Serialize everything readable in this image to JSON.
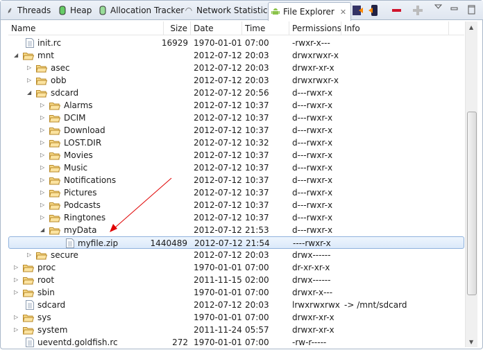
{
  "tabs": [
    {
      "label": "Threads",
      "icon": "threads-icon"
    },
    {
      "label": "Heap",
      "icon": "heap-icon"
    },
    {
      "label": "Allocation Tracker",
      "icon": "allocation-icon"
    },
    {
      "label": "Network Statistics",
      "icon": "wifi-icon"
    },
    {
      "label": "File Explorer",
      "icon": "android-icon",
      "active": true
    }
  ],
  "toolbar": [
    "pull-file-icon",
    "push-file-icon",
    "delete-icon",
    "new-folder-icon",
    "view-menu-icon",
    "minimize-icon",
    "maximize-icon"
  ],
  "columns": [
    "Name",
    "Size",
    "Date",
    "Time",
    "Permissions",
    "Info"
  ],
  "rows": [
    {
      "name": "init.rc",
      "type": "file",
      "depth": 0,
      "size": "16929",
      "date": "1970-01-01",
      "time": "07:00",
      "perm": "-rwxr-x---",
      "info": ""
    },
    {
      "name": "mnt",
      "type": "folder",
      "depth": 0,
      "expanded": true,
      "size": "",
      "date": "2012-07-12",
      "time": "20:03",
      "perm": "drwxrwxr-x",
      "info": ""
    },
    {
      "name": "asec",
      "type": "folder",
      "depth": 1,
      "size": "",
      "date": "2012-07-12",
      "time": "20:03",
      "perm": "drwxr-xr-x",
      "info": ""
    },
    {
      "name": "obb",
      "type": "folder",
      "depth": 1,
      "size": "",
      "date": "2012-07-12",
      "time": "20:03",
      "perm": "drwxrwxr-x",
      "info": ""
    },
    {
      "name": "sdcard",
      "type": "folder",
      "depth": 1,
      "expanded": true,
      "size": "",
      "date": "2012-07-12",
      "time": "20:56",
      "perm": "d---rwxr-x",
      "info": ""
    },
    {
      "name": "Alarms",
      "type": "folder",
      "depth": 2,
      "size": "",
      "date": "2012-07-12",
      "time": "10:37",
      "perm": "d---rwxr-x",
      "info": ""
    },
    {
      "name": "DCIM",
      "type": "folder",
      "depth": 2,
      "size": "",
      "date": "2012-07-12",
      "time": "10:37",
      "perm": "d---rwxr-x",
      "info": ""
    },
    {
      "name": "Download",
      "type": "folder",
      "depth": 2,
      "size": "",
      "date": "2012-07-12",
      "time": "10:37",
      "perm": "d---rwxr-x",
      "info": ""
    },
    {
      "name": "LOST.DIR",
      "type": "folder",
      "depth": 2,
      "size": "",
      "date": "2012-07-12",
      "time": "10:32",
      "perm": "d---rwxr-x",
      "info": ""
    },
    {
      "name": "Movies",
      "type": "folder",
      "depth": 2,
      "size": "",
      "date": "2012-07-12",
      "time": "10:37",
      "perm": "d---rwxr-x",
      "info": ""
    },
    {
      "name": "Music",
      "type": "folder",
      "depth": 2,
      "size": "",
      "date": "2012-07-12",
      "time": "10:37",
      "perm": "d---rwxr-x",
      "info": ""
    },
    {
      "name": "Notifications",
      "type": "folder",
      "depth": 2,
      "size": "",
      "date": "2012-07-12",
      "time": "10:37",
      "perm": "d---rwxr-x",
      "info": ""
    },
    {
      "name": "Pictures",
      "type": "folder",
      "depth": 2,
      "size": "",
      "date": "2012-07-12",
      "time": "10:37",
      "perm": "d---rwxr-x",
      "info": ""
    },
    {
      "name": "Podcasts",
      "type": "folder",
      "depth": 2,
      "size": "",
      "date": "2012-07-12",
      "time": "10:37",
      "perm": "d---rwxr-x",
      "info": ""
    },
    {
      "name": "Ringtones",
      "type": "folder",
      "depth": 2,
      "size": "",
      "date": "2012-07-12",
      "time": "10:37",
      "perm": "d---rwxr-x",
      "info": ""
    },
    {
      "name": "myData",
      "type": "folder",
      "depth": 2,
      "expanded": true,
      "size": "",
      "date": "2012-07-12",
      "time": "21:53",
      "perm": "d---rwxr-x",
      "info": ""
    },
    {
      "name": "myfile.zip",
      "type": "file",
      "depth": 3,
      "selected": true,
      "size": "1440489",
      "date": "2012-07-12",
      "time": "21:54",
      "perm": "----rwxr-x",
      "info": ""
    },
    {
      "name": "secure",
      "type": "folder",
      "depth": 1,
      "size": "",
      "date": "2012-07-12",
      "time": "20:03",
      "perm": "drwx------",
      "info": ""
    },
    {
      "name": "proc",
      "type": "folder",
      "depth": 0,
      "size": "",
      "date": "1970-01-01",
      "time": "07:00",
      "perm": "dr-xr-xr-x",
      "info": ""
    },
    {
      "name": "root",
      "type": "folder",
      "depth": 0,
      "size": "",
      "date": "2011-11-15",
      "time": "02:00",
      "perm": "drwx------",
      "info": ""
    },
    {
      "name": "sbin",
      "type": "folder",
      "depth": 0,
      "size": "",
      "date": "1970-01-01",
      "time": "07:00",
      "perm": "drwxr-x---",
      "info": ""
    },
    {
      "name": "sdcard",
      "type": "file",
      "depth": 0,
      "size": "",
      "date": "2012-07-12",
      "time": "20:03",
      "perm": "lrwxrwxrwx",
      "info": "-> /mnt/sdcard"
    },
    {
      "name": "sys",
      "type": "folder",
      "depth": 0,
      "size": "",
      "date": "1970-01-01",
      "time": "07:00",
      "perm": "drwxr-xr-x",
      "info": ""
    },
    {
      "name": "system",
      "type": "folder",
      "depth": 0,
      "size": "",
      "date": "2011-11-24",
      "time": "05:57",
      "perm": "drwxr-xr-x",
      "info": ""
    },
    {
      "name": "ueventd.goldfish.rc",
      "type": "file",
      "depth": 0,
      "size": "272",
      "date": "1970-01-01",
      "time": "07:00",
      "perm": "-rw-r-----",
      "info": ""
    }
  ],
  "colors": {
    "selection": "#dbe9fa",
    "annotation_arrow": "#e00000",
    "folder": "#f0c050"
  }
}
